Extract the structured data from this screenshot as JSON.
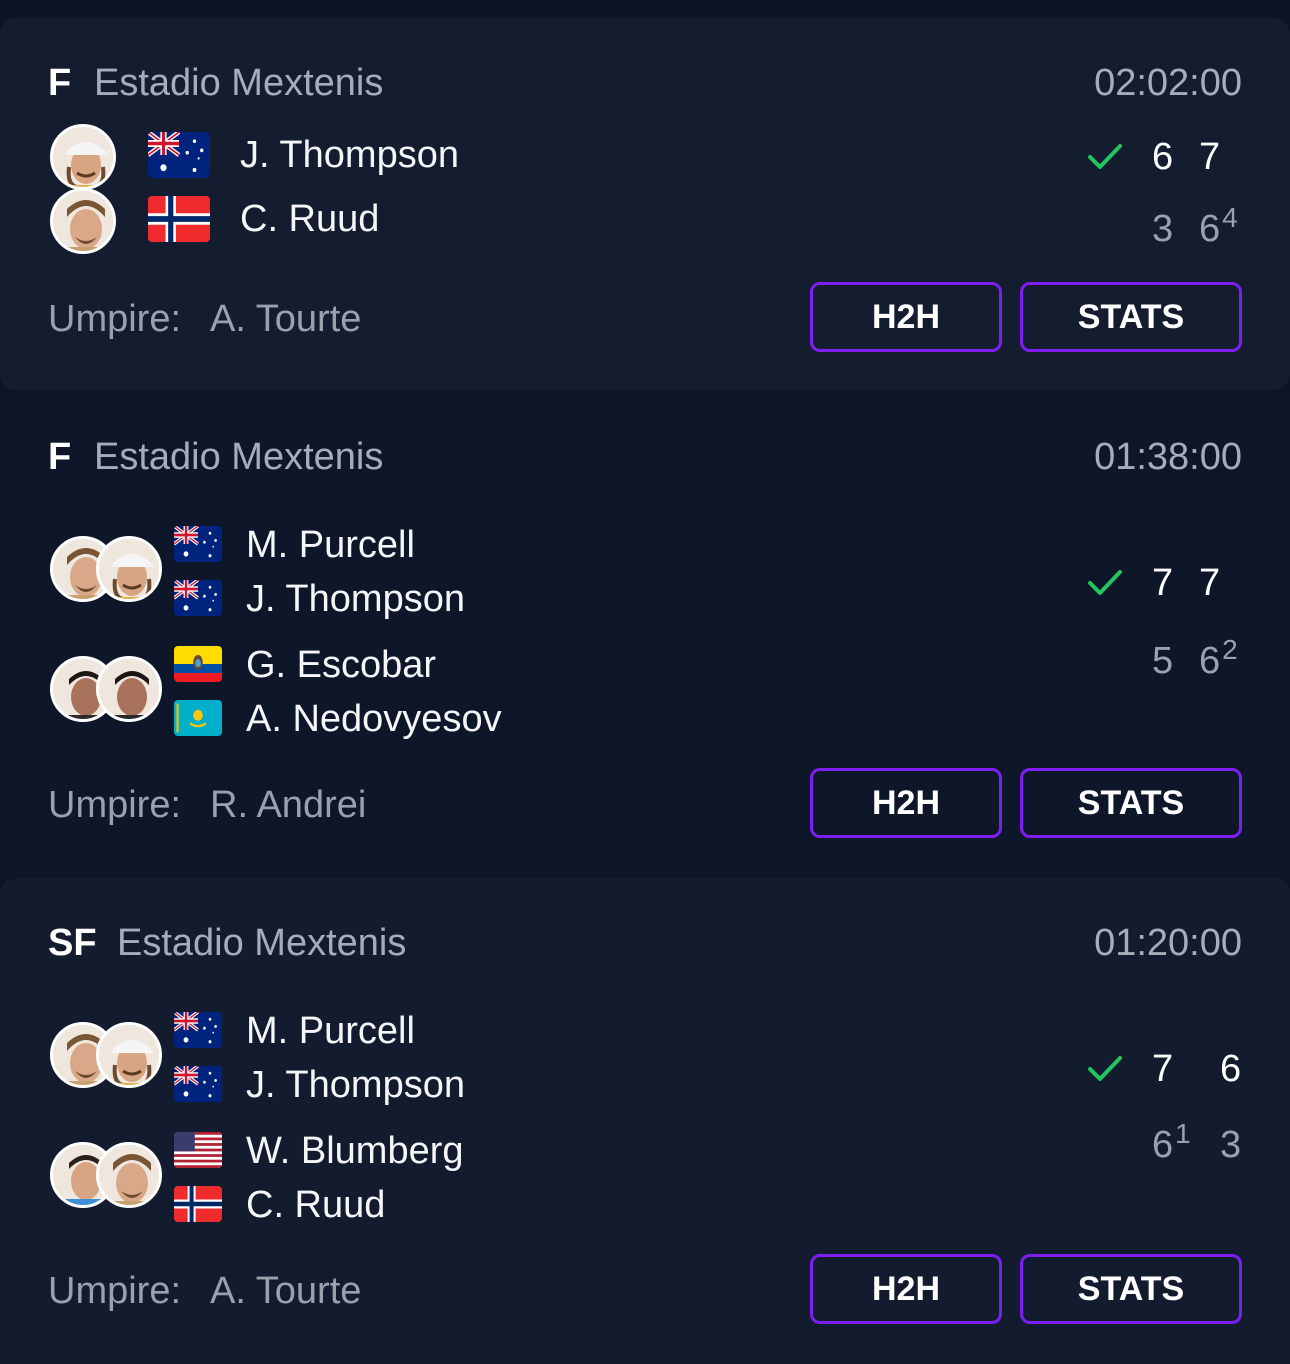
{
  "matches": [
    {
      "round": "F",
      "venue": "Estadio Mextenis",
      "duration": "02:02:00",
      "team1": {
        "players": [
          {
            "name": "J. Thompson",
            "flag": "AU"
          }
        ],
        "sets": [
          "6",
          "7"
        ],
        "tiebreaks": [
          "",
          ""
        ],
        "winner": true
      },
      "team2": {
        "players": [
          {
            "name": "C. Ruud",
            "flag": "NO"
          }
        ],
        "sets": [
          "3",
          "6"
        ],
        "tiebreaks": [
          "",
          "4"
        ]
      },
      "umpire_label": "Umpire:",
      "umpire": "A. Tourte",
      "h2h_label": "H2H",
      "stats_label": "STATS"
    },
    {
      "round": "F",
      "venue": "Estadio Mextenis",
      "duration": "01:38:00",
      "team1": {
        "players": [
          {
            "name": "M. Purcell",
            "flag": "AU"
          },
          {
            "name": "J. Thompson",
            "flag": "AU"
          }
        ],
        "sets": [
          "7",
          "7"
        ],
        "tiebreaks": [
          "",
          ""
        ],
        "winner": true
      },
      "team2": {
        "players": [
          {
            "name": "G. Escobar",
            "flag": "EC"
          },
          {
            "name": "A. Nedovyesov",
            "flag": "KZ"
          }
        ],
        "sets": [
          "5",
          "6"
        ],
        "tiebreaks": [
          "",
          "2"
        ]
      },
      "umpire_label": "Umpire:",
      "umpire": "R. Andrei",
      "h2h_label": "H2H",
      "stats_label": "STATS"
    },
    {
      "round": "SF",
      "venue": "Estadio Mextenis",
      "duration": "01:20:00",
      "team1": {
        "players": [
          {
            "name": "M. Purcell",
            "flag": "AU"
          },
          {
            "name": "J. Thompson",
            "flag": "AU"
          }
        ],
        "sets": [
          "7",
          "6"
        ],
        "tiebreaks": [
          "",
          ""
        ],
        "winner": true
      },
      "team2": {
        "players": [
          {
            "name": "W. Blumberg",
            "flag": "US"
          },
          {
            "name": "C. Ruud",
            "flag": "NO"
          }
        ],
        "sets": [
          "6",
          "3"
        ],
        "tiebreaks": [
          "1",
          ""
        ]
      },
      "umpire_label": "Umpire:",
      "umpire": "A. Tourte",
      "h2h_label": "H2H",
      "stats_label": "STATS"
    }
  ],
  "colors": {
    "background": "#0b1527",
    "card": "#141d2f",
    "accent": "#7e1ef0",
    "check": "#22c55e",
    "muted": "#9aa1ad"
  }
}
